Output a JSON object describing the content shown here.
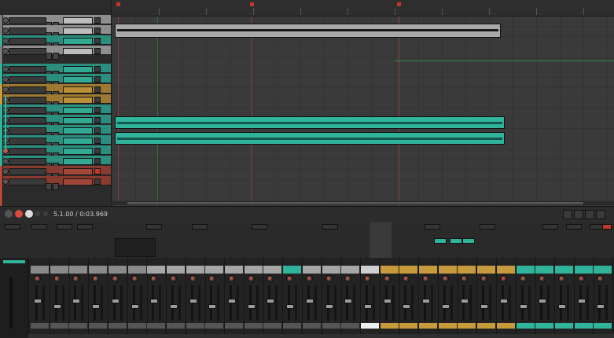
{
  "transport": {
    "time": "5.1.00 / 0:03.969"
  },
  "colors": {
    "teal": "#2fb39b",
    "tan": "#c79a3c",
    "red": "#b44a3c",
    "gray_item": "#a9a9a9",
    "dark_bg": "#262626",
    "record": "#d84a3a"
  },
  "tracks": [
    {
      "color": "#7d7d7d"
    },
    {
      "color": "#7d7d7d"
    },
    {
      "color": "#2fb39b"
    },
    {
      "color": "#7d7d7d"
    },
    {
      "color": "#2fb39b"
    },
    {
      "color": "#2fb39b"
    },
    {
      "color": "#c79a3c"
    },
    {
      "color": "#c79a3c"
    },
    {
      "color": "#2fb39b"
    },
    {
      "color": "#2fb39b"
    },
    {
      "color": "#2fb39b"
    },
    {
      "color": "#2fb39b"
    },
    {
      "color": "#2fb39b"
    },
    {
      "color": "#2fb39b"
    },
    {
      "color": "#b44a3c"
    },
    {
      "color": "#b44a3c"
    }
  ],
  "mixer_strips": [
    "#8a8a8a",
    "#8a8a8a",
    "#8a8a8a",
    "#8a8a8a",
    "#8a8a8a",
    "#8a8a8a",
    "#a6a6a6",
    "#a6a6a6",
    "#a6a6a6",
    "#a6a6a6",
    "#a6a6a6",
    "#a6a6a6",
    "#a6a6a6",
    "#2fb39b",
    "#a6a6a6",
    "#a6a6a6",
    "#a6a6a6",
    "#cfcfcf",
    "#c79a3c",
    "#c79a3c",
    "#c79a3c",
    "#c79a3c",
    "#c79a3c",
    "#c79a3c",
    "#c79a3c",
    "#2fb39b",
    "#2fb39b",
    "#2fb39b",
    "#2fb39b",
    "#2fb39b"
  ]
}
